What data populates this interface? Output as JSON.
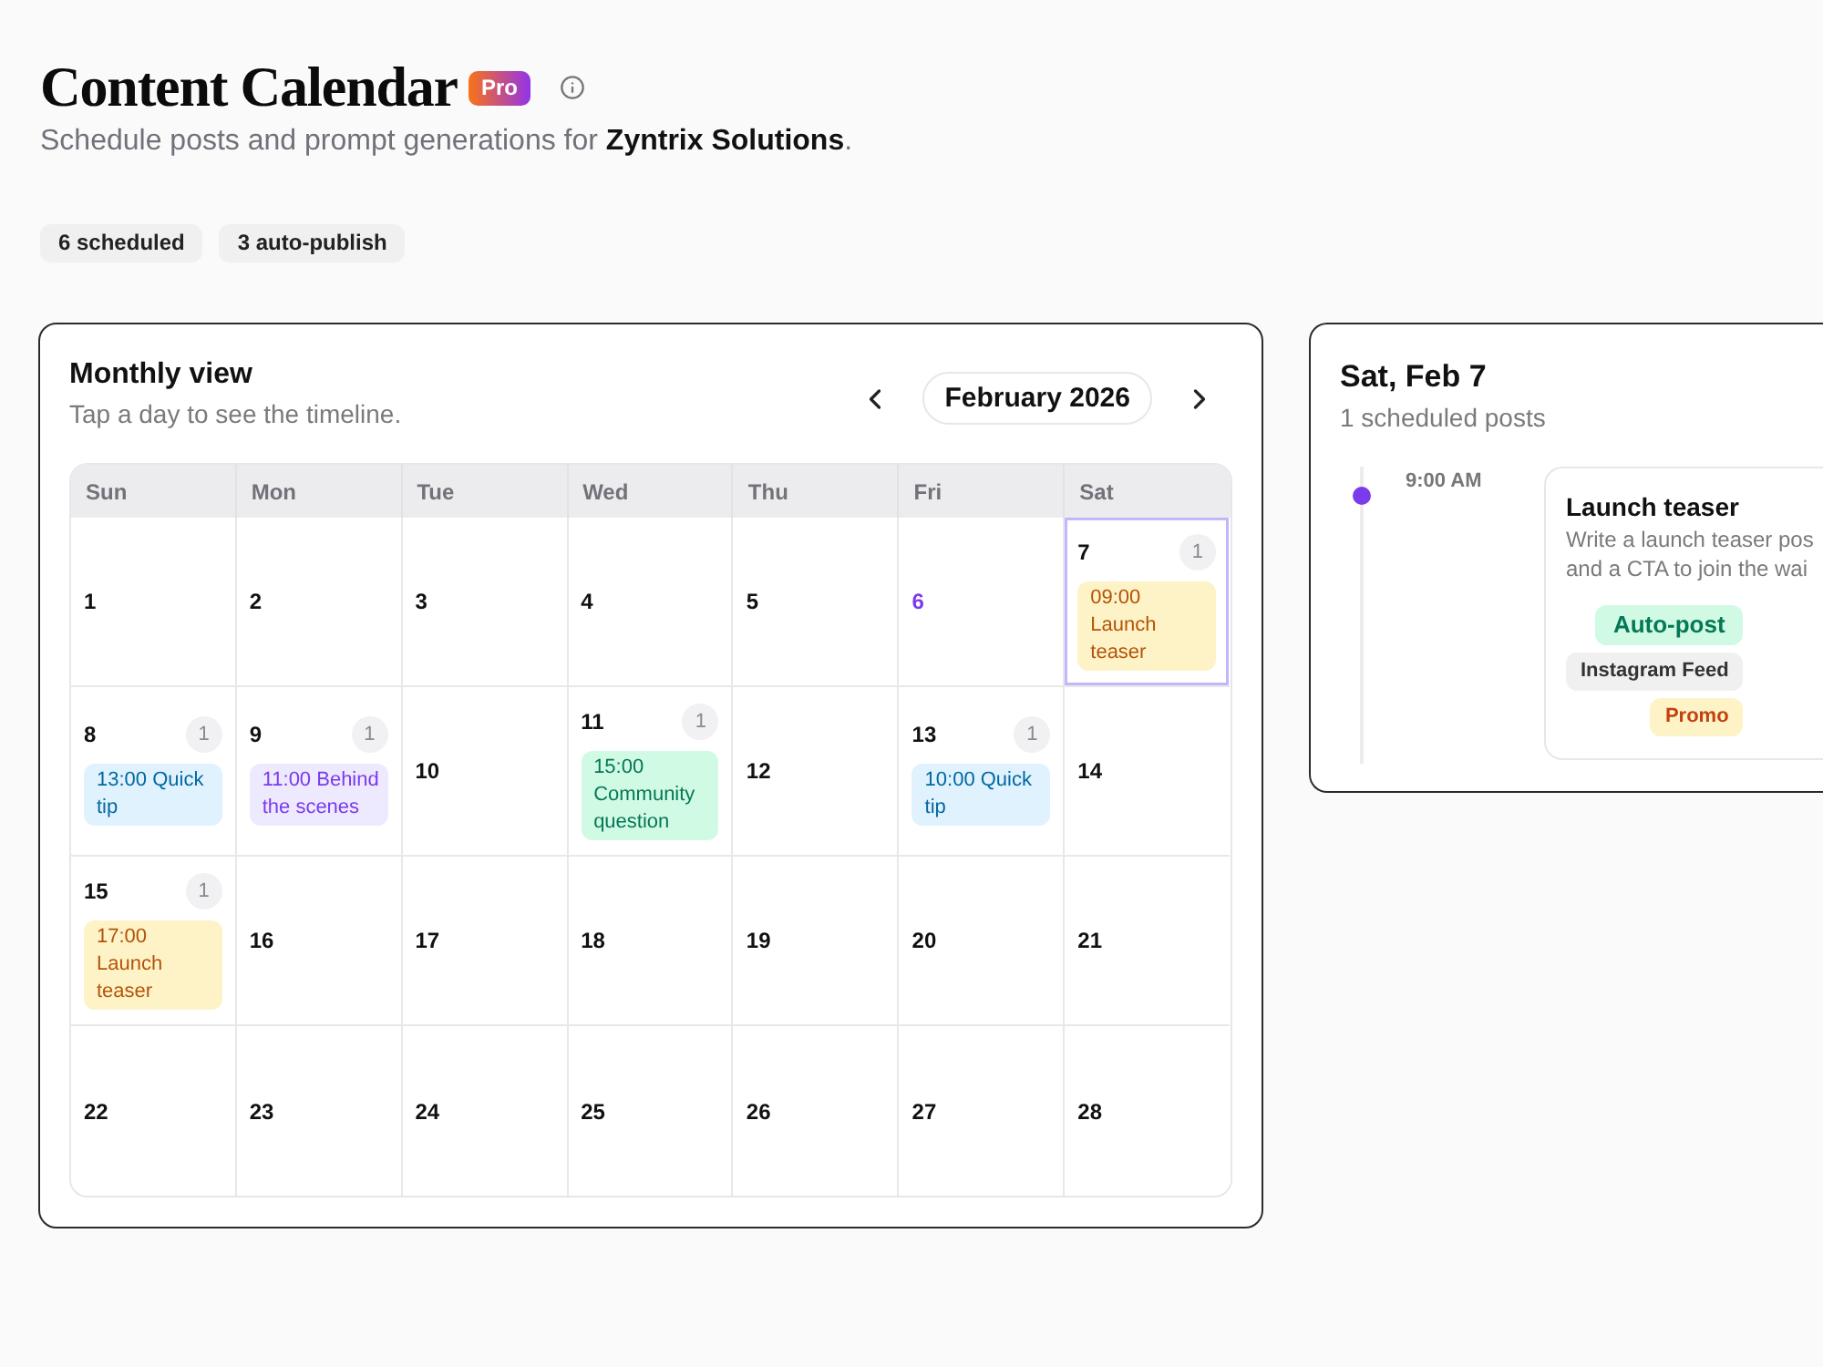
{
  "header": {
    "title": "Content Calendar",
    "badge": "Pro",
    "subtitle": "Schedule posts and prompt generations for **Zyntrix Solutions**."
  },
  "stats": [
    "6 scheduled",
    "3 auto-publish"
  ],
  "calendar": {
    "title": "Monthly view",
    "subtitle": "Tap a day to see the timeline.",
    "month": "February 2026",
    "weekdays": [
      "Sun",
      "Mon",
      "Tue",
      "Wed",
      "Thu",
      "Fri",
      "Sat"
    ],
    "days": [
      {
        "day": "1",
        "selected": false,
        "today": false
      },
      {
        "day": "2",
        "selected": false,
        "today": false
      },
      {
        "day": "3",
        "selected": false,
        "today": false
      },
      {
        "day": "4",
        "selected": false,
        "today": false
      },
      {
        "day": "5",
        "selected": false,
        "today": false
      },
      {
        "day": "6",
        "selected": false,
        "today": true
      },
      {
        "day": "7",
        "selected": true,
        "today": false,
        "count": "1",
        "posts": [
          {
            "time": "09:00",
            "title": "Launch teaser",
            "color": "#fef3c7"
          }
        ]
      },
      {
        "day": "8",
        "selected": false,
        "today": false,
        "count": "1",
        "posts": [
          {
            "time": "13:00",
            "title": "Quick tip",
            "color": "#e0f2fe"
          }
        ]
      },
      {
        "day": "9",
        "selected": false,
        "today": false,
        "count": "1",
        "posts": [
          {
            "time": "11:00",
            "title": "Behind the scenes",
            "color": "#ede9fe"
          }
        ]
      },
      {
        "day": "10",
        "selected": false,
        "today": false
      },
      {
        "day": "11",
        "selected": false,
        "today": false,
        "count": "1",
        "posts": [
          {
            "time": "15:00",
            "title": "Community question",
            "color": "#d1fae5"
          }
        ]
      },
      {
        "day": "12",
        "selected": false,
        "today": false
      },
      {
        "day": "13",
        "selected": false,
        "today": false,
        "count": "1",
        "posts": [
          {
            "time": "10:00",
            "title": "Quick tip",
            "color": "#e0f2fe"
          }
        ]
      },
      {
        "day": "14",
        "selected": false,
        "today": false
      },
      {
        "day": "15",
        "selected": false,
        "today": false,
        "count": "1",
        "posts": [
          {
            "time": "17:00",
            "title": "Launch teaser",
            "color": "#fef3c7"
          }
        ]
      },
      {
        "day": "16",
        "selected": false,
        "today": false
      },
      {
        "day": "17",
        "selected": false,
        "today": false
      },
      {
        "day": "18",
        "selected": false,
        "today": false
      },
      {
        "day": "19",
        "selected": false,
        "today": false
      },
      {
        "day": "20",
        "selected": false,
        "today": false
      },
      {
        "day": "21",
        "selected": false,
        "today": false
      },
      {
        "day": "22",
        "selected": false,
        "today": false
      },
      {
        "day": "23",
        "selected": false,
        "today": false
      },
      {
        "day": "24",
        "selected": false,
        "today": false
      },
      {
        "day": "25",
        "selected": false,
        "today": false
      },
      {
        "day": "26",
        "selected": false,
        "today": false
      },
      {
        "day": "27",
        "selected": false,
        "today": false
      },
      {
        "day": "28",
        "selected": false,
        "today": false
      }
    ]
  },
  "day_panel": {
    "title": "Sat, Feb 7",
    "subtitle": "1 scheduled posts",
    "entries": [
      {
        "time": "9:00 AM",
        "title": "Launch teaser",
        "description": [
          "Write a launch teaser pos",
          "and a CTA to join the wai"
        ],
        "tags": [
          {
            "label": "Auto-post",
            "kind": "status"
          },
          {
            "label": "Instagram Feed",
            "kind": "channel"
          },
          {
            "label": "Promo",
            "kind": "category"
          }
        ]
      }
    ]
  }
}
